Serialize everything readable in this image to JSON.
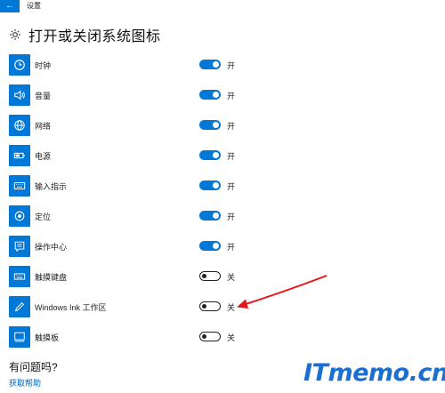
{
  "window": {
    "title": "设置",
    "back_icon": "back-arrow-icon"
  },
  "page": {
    "title": "打开或关闭系统图标",
    "title_icon": "gear-icon"
  },
  "accent_color": "#0078d7",
  "items": [
    {
      "label": "时钟",
      "icon": "clock-icon",
      "on": true,
      "state": "开"
    },
    {
      "label": "音量",
      "icon": "volume-icon",
      "on": true,
      "state": "开"
    },
    {
      "label": "网络",
      "icon": "globe-icon",
      "on": true,
      "state": "开"
    },
    {
      "label": "电源",
      "icon": "battery-icon",
      "on": true,
      "state": "开"
    },
    {
      "label": "输入指示",
      "icon": "keyboard-icon",
      "on": true,
      "state": "开"
    },
    {
      "label": "定位",
      "icon": "location-icon",
      "on": true,
      "state": "开"
    },
    {
      "label": "操作中心",
      "icon": "action-center-icon",
      "on": true,
      "state": "开"
    },
    {
      "label": "触摸键盘",
      "icon": "touch-keyboard-icon",
      "on": false,
      "state": "关"
    },
    {
      "label": "Windows Ink 工作区",
      "icon": "pen-icon",
      "on": false,
      "state": "关"
    },
    {
      "label": "触摸板",
      "icon": "touchpad-icon",
      "on": false,
      "state": "关"
    }
  ],
  "help": {
    "title": "有问题吗?",
    "link": "获取帮助"
  },
  "watermark": "ITmemo.cn"
}
